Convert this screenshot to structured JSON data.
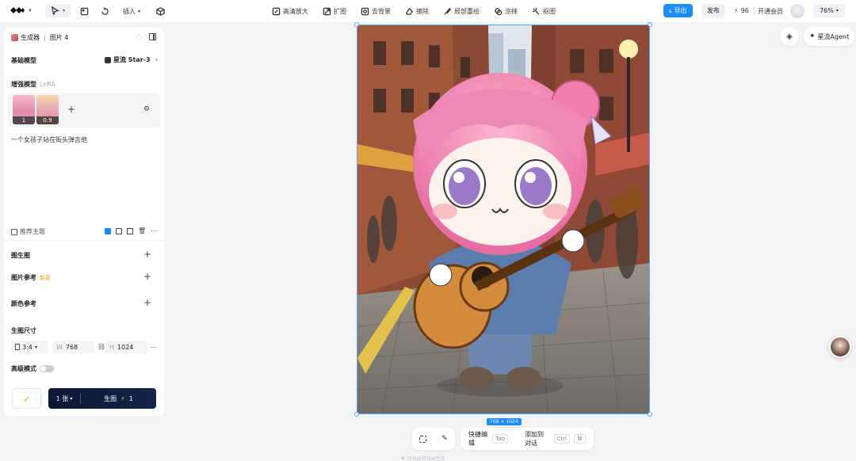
{
  "toolbar": {
    "insert_label": "插入",
    "tools": [
      {
        "icon": "upscale-icon",
        "label": "高清放大"
      },
      {
        "icon": "expand-icon",
        "label": "扩图"
      },
      {
        "icon": "remove-bg-icon",
        "label": "去背景"
      },
      {
        "icon": "erase-icon",
        "label": "擦除"
      },
      {
        "icon": "repaint-icon",
        "label": "局部重绘"
      },
      {
        "icon": "smear-icon",
        "label": "涂抹"
      },
      {
        "icon": "cutout-icon",
        "label": "抠图"
      }
    ],
    "export_label": "导出",
    "publish_label": "发布",
    "credits": "96",
    "membership_label": "开通会员",
    "zoom": "76%"
  },
  "panel": {
    "breadcrumb_generator": "生成器",
    "breadcrumb_image": "图片 4",
    "base_model_label": "基础模型",
    "base_model_value": "星流 Star-3",
    "lora_label": "增强模型",
    "lora_sub": "LoRA",
    "lora_weights": [
      "1",
      "0.9"
    ],
    "prompt": "一个女孩子站在街头弹吉他",
    "recommend_label": "推荐主题",
    "img2img_label": "图生图",
    "image_ref_label": "图片参考",
    "image_ref_badge": "新奇",
    "color_ref_label": "颜色参考",
    "size_label": "生图尺寸",
    "ratio": "3:4",
    "width_prefix": "W",
    "width": "768",
    "height_prefix": "H",
    "height": "1024",
    "advanced_label": "高级模式",
    "count_label": "1 张",
    "generate_label": "生图",
    "generate_cost": "1"
  },
  "canvas": {
    "size_badge": "768 × 1024"
  },
  "right": {
    "agent_label": "星流Agent"
  },
  "bottom": {
    "quick_edit_label": "快捷编辑",
    "quick_edit_key": "Tab",
    "add_chat_label": "添加到对话",
    "add_chat_key": "Ctrl",
    "footer_note": "内容由星流AI生成"
  },
  "colors": {
    "accent": "#1a8cff",
    "generate_bg": "#0f1d3d",
    "selection": "#5aa7ff"
  }
}
